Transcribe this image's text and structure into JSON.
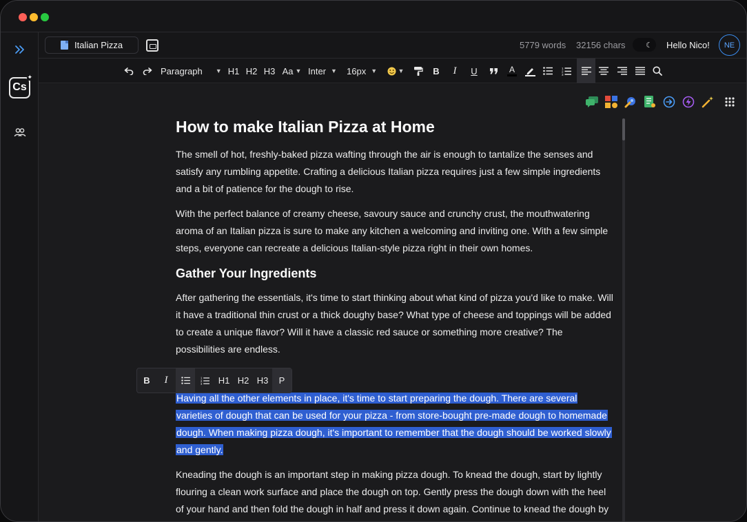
{
  "doc_tab": {
    "title": "Italian Pizza"
  },
  "stats": {
    "words": "5779 words",
    "chars": "32156 chars"
  },
  "user": {
    "greeting": "Hello Nico!",
    "initials": "NE"
  },
  "sidebar": {
    "logo": "Cs"
  },
  "toolbar": {
    "block_type": "Paragraph",
    "h1": "H1",
    "h2": "H2",
    "h3": "H3",
    "case_label": "Aa",
    "font_family": "Inter",
    "font_size": "16px"
  },
  "bubble": {
    "bold": "B",
    "italic": "I",
    "h1": "H1",
    "h2": "H2",
    "h3": "H3",
    "paragraph": "P"
  },
  "document": {
    "title": "How to make Italian Pizza at Home",
    "p1": "The smell of hot, freshly-baked pizza wafting through the air is enough to tantalize the senses and satisfy any rumbling appetite. Crafting a delicious Italian pizza requires just a few simple ingredients and a bit of patience for the dough to rise.",
    "p2": "With the perfect balance of creamy cheese, savoury sauce and crunchy crust, the mouthwatering aroma of an Italian pizza is sure to make any kitchen a welcoming and inviting one. With a few simple steps, everyone can recreate a delicious Italian-style pizza right in their own homes.",
    "h2": "Gather Your Ingredients",
    "p3": "After gathering the essentials, it's time to start thinking about what kind of pizza you'd like to make. Will it have a traditional thin crust or a thick doughy base? What type of cheese and toppings will be added to create a unique flavor? Will it have a classic red sauce or something more creative? The possibilities are endless.",
    "p4": "Having all the other elements in place, it's time to start preparing the dough. There are several varieties of dough that can be used for your pizza - from store-bought pre-made dough to homemade dough. When making pizza dough, it's important to remember that the dough should be worked slowly and gently.",
    "p5": "Kneading the dough is an important step in making pizza dough. To knead the dough, start by lightly flouring a clean work surface and place the dough on top. Gently press the dough down with the heel of your hand and then fold the dough in half and press it down again. Continue to knead the dough by"
  },
  "colors": {
    "selection": "#2f5fd1",
    "accent": "#3b8df0",
    "background": "#1b1b1d"
  }
}
